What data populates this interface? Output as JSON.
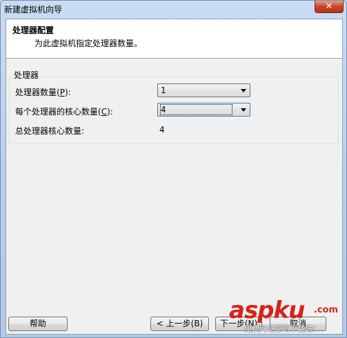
{
  "window": {
    "title": "新建虚拟机向导",
    "close_glyph": "✕"
  },
  "header": {
    "title": "处理器配置",
    "subtitle": "为此虚拟机指定处理器数量。"
  },
  "processors": {
    "group_label": "处理器",
    "count_label_prefix": "处理器数量(",
    "count_label_key": "P",
    "count_label_suffix": "):",
    "count_value": "1",
    "cores_label_prefix": "每个处理器的核心数量(",
    "cores_label_key": "C",
    "cores_label_suffix": "):",
    "cores_value": "4",
    "total_label": "总处理器核心数量:",
    "total_value": "4"
  },
  "buttons": {
    "help": "帮助",
    "back": "< 上一步(B)",
    "next": "下一步(N)",
    "cancel": "取消"
  },
  "watermark": {
    "main": "aspku",
    "domain": ".com",
    "sub": "免费网站源码下载站!"
  },
  "colors": {
    "watermark": "#d5241c",
    "focus_border": "#3c7fb1"
  }
}
